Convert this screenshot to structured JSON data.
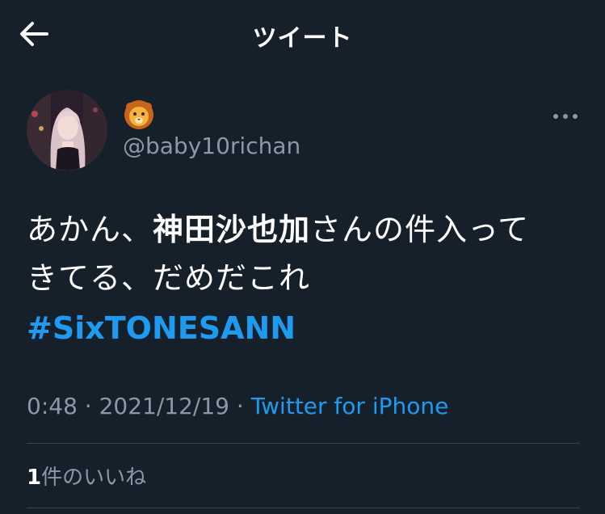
{
  "header": {
    "title": "ツイート",
    "back_icon": "arrow-left-icon"
  },
  "author": {
    "display_name_icon": "lion-face-emoji",
    "handle": "@baby10richan",
    "more_icon": "ellipsis-icon"
  },
  "tweet": {
    "text_part1": "あかん、",
    "text_bold": "神田沙也加",
    "text_part2": "さんの件入って",
    "text_line2": "きてる、だめだこれ",
    "hashtag": "#SixTONESANN"
  },
  "meta": {
    "time": "0:48",
    "separator": " · ",
    "date": "2021/12/19",
    "source": "Twitter for iPhone"
  },
  "engagement": {
    "likes_count": "1",
    "likes_label": "件のいいね"
  },
  "colors": {
    "background": "#15202b",
    "accent": "#1d9bf0",
    "secondary_text": "#8b98a5",
    "divider": "#38444d"
  }
}
